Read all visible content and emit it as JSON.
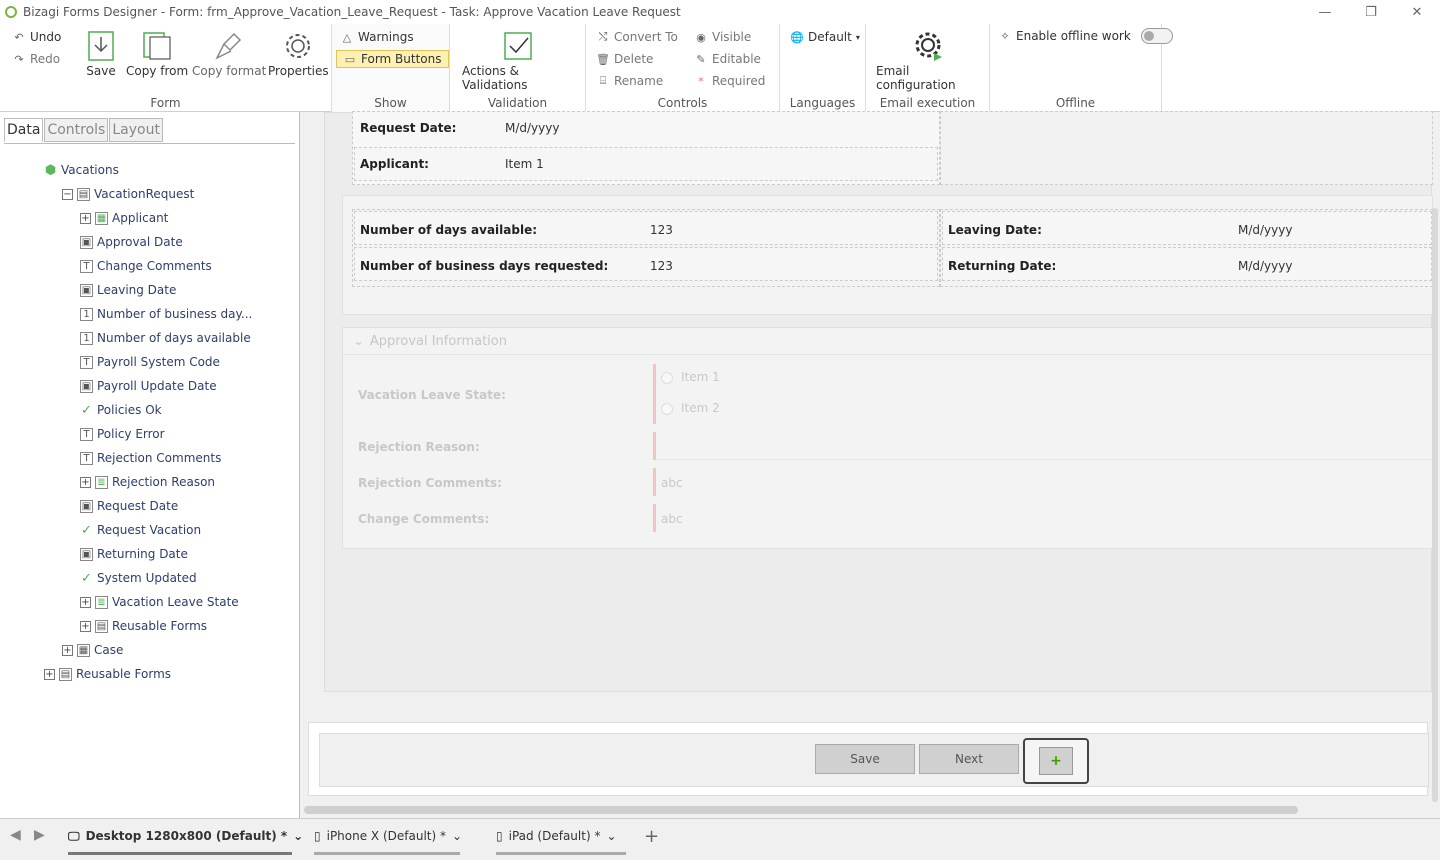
{
  "window": {
    "title": "Bizagi Forms Designer  - Form: frm_Approve_Vacation_Leave_Request - Task:  Approve Vacation Leave Request",
    "minimize": "—",
    "restore": "❐",
    "close": "✕"
  },
  "ribbon": {
    "form": {
      "undo": "Undo",
      "redo": "Redo",
      "save": "Save",
      "copy_from": "Copy from",
      "copy_format": "Copy format",
      "properties": "Properties",
      "label": "Form"
    },
    "show": {
      "warnings": "Warnings",
      "form_buttons": "Form Buttons",
      "label": "Show"
    },
    "validation": {
      "actions": "Actions & Validations",
      "label": "Validation"
    },
    "controls": {
      "convert_to": "Convert To",
      "delete": "Delete",
      "rename": "Rename",
      "visible": "Visible",
      "editable": "Editable",
      "required": "Required",
      "label": "Controls"
    },
    "languages": {
      "default": "Default",
      "label": "Languages"
    },
    "email": {
      "config": "Email configuration",
      "label": "Email execution"
    },
    "offline": {
      "enable": "Enable offline work",
      "label": "Offline"
    }
  },
  "left_panel": {
    "tabs": [
      "Data",
      "Controls",
      "Layout"
    ],
    "tree": [
      {
        "label": "Vacations",
        "icon": "cube-icon"
      },
      {
        "label": "VacationRequest",
        "icon": "entity-icon"
      },
      {
        "label": "Applicant",
        "icon": "table-icon"
      },
      {
        "label": "Approval Date",
        "icon": "date-icon"
      },
      {
        "label": "Change Comments",
        "icon": "text-icon"
      },
      {
        "label": "Leaving Date",
        "icon": "date-icon"
      },
      {
        "label": "Number of business day...",
        "icon": "number-icon"
      },
      {
        "label": "Number of days available",
        "icon": "number-icon"
      },
      {
        "label": "Payroll System Code",
        "icon": "text-icon"
      },
      {
        "label": "Payroll Update Date",
        "icon": "date-icon"
      },
      {
        "label": "Policies Ok",
        "icon": "check-icon"
      },
      {
        "label": "Policy Error",
        "icon": "text-icon"
      },
      {
        "label": "Rejection Comments",
        "icon": "text-icon"
      },
      {
        "label": "Rejection Reason",
        "icon": "list-icon"
      },
      {
        "label": "Request Date",
        "icon": "date-icon"
      },
      {
        "label": "Request Vacation",
        "icon": "check-icon"
      },
      {
        "label": "Returning Date",
        "icon": "date-icon"
      },
      {
        "label": "System Updated",
        "icon": "check-icon"
      },
      {
        "label": "Vacation Leave State",
        "icon": "list-icon"
      },
      {
        "label": "Reusable Forms",
        "icon": "forms-icon"
      },
      {
        "label": "Case",
        "icon": "grid-icon"
      },
      {
        "label": "Reusable Forms",
        "icon": "forms-icon"
      }
    ]
  },
  "form": {
    "request_date_label": "Request Date:",
    "request_date_value": "M/d/yyyy",
    "applicant_label": "Applicant:",
    "applicant_value": "Item 1",
    "days_available_label": "Number of days available:",
    "days_available_value": "123",
    "business_days_label": "Number of business days requested:",
    "business_days_value": "123",
    "leaving_date_label": "Leaving Date:",
    "leaving_date_value": "M/d/yyyy",
    "returning_date_label": "Returning Date:",
    "returning_date_value": "M/d/yyyy",
    "approval": {
      "title": "Approval Information",
      "state_label": "Vacation Leave State:",
      "option1": "Item 1",
      "option2": "Item 2",
      "rejection_reason_label": "Rejection Reason:",
      "rejection_comments_label": "Rejection Comments:",
      "rejection_comments_placeholder": "abc",
      "change_comments_label": "Change Comments:",
      "change_comments_placeholder": "abc"
    }
  },
  "buttons": {
    "save": "Save",
    "next": "Next",
    "add": "+"
  },
  "bottom_tabs": [
    {
      "label": "Desktop 1280x800 (Default) *",
      "active": true
    },
    {
      "label": "iPhone X (Default) *",
      "active": false
    },
    {
      "label": "iPad (Default) *",
      "active": false
    }
  ],
  "bottom_add": "+"
}
